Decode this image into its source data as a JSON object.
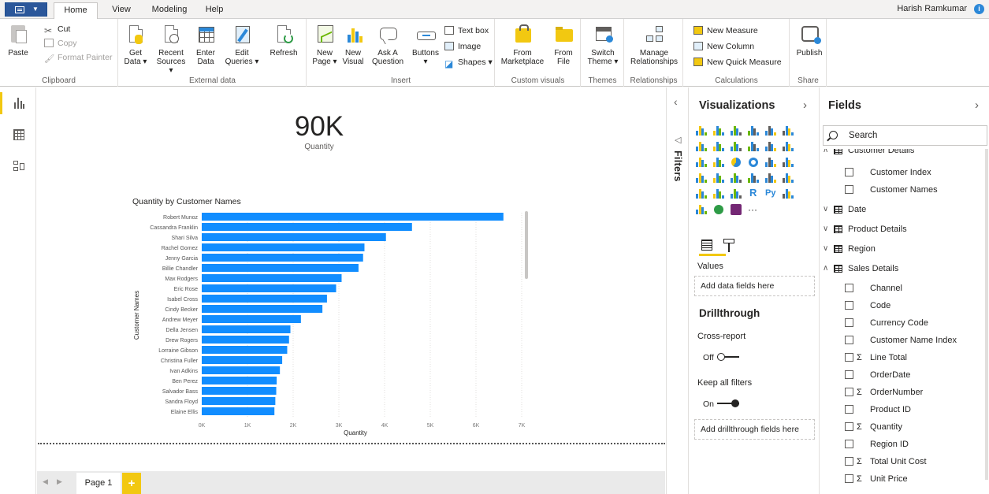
{
  "titlebar": {
    "tabs": [
      "Home",
      "View",
      "Modeling",
      "Help"
    ],
    "active_tab": "Home",
    "user": "Harish Ramkumar"
  },
  "ribbon": {
    "clipboard": {
      "label": "Clipboard",
      "paste": "Paste",
      "cut": "Cut",
      "copy": "Copy",
      "format_painter": "Format Painter"
    },
    "external_data": {
      "label": "External data",
      "get_data": [
        "Get",
        "Data ▾"
      ],
      "recent_sources": [
        "Recent",
        "Sources ▾"
      ],
      "enter_data": [
        "Enter",
        "Data"
      ],
      "edit_queries": [
        "Edit",
        "Queries ▾"
      ],
      "refresh": "Refresh"
    },
    "insert": {
      "label": "Insert",
      "new_page": [
        "New",
        "Page ▾"
      ],
      "new_visual": [
        "New",
        "Visual"
      ],
      "ask_question": [
        "Ask A",
        "Question"
      ],
      "buttons": [
        "Buttons",
        "▾"
      ],
      "text_box": "Text box",
      "image": "Image",
      "shapes": "Shapes ▾"
    },
    "custom_visuals": {
      "label": "Custom visuals",
      "from_marketplace": [
        "From",
        "Marketplace"
      ],
      "from_file": [
        "From",
        "File"
      ]
    },
    "themes": {
      "label": "Themes",
      "switch_theme": [
        "Switch",
        "Theme ▾"
      ]
    },
    "relationships": {
      "label": "Relationships",
      "manage": [
        "Manage",
        "Relationships"
      ]
    },
    "calculations": {
      "label": "Calculations",
      "new_measure": "New Measure",
      "new_column": "New Column",
      "new_quick_measure": "New Quick Measure"
    },
    "share": {
      "label": "Share",
      "publish": "Publish"
    }
  },
  "card": {
    "value": "90K",
    "label": "Quantity"
  },
  "chart_data": {
    "type": "bar",
    "orientation": "horizontal",
    "title": "Quantity by Customer Names",
    "xlabel": "Quantity",
    "ylabel": "Customer Names",
    "xlim": [
      0,
      7000
    ],
    "x_ticks": [
      "0K",
      "1K",
      "2K",
      "3K",
      "4K",
      "5K",
      "6K",
      "7K"
    ],
    "categories": [
      "Robert Munoz",
      "Cassandra Franklin",
      "Shari Silva",
      "Rachel Gomez",
      "Jenny Garcia",
      "Billie Chandler",
      "Max Rodgers",
      "Eric Rose",
      "Isabel Cross",
      "Cindy Becker",
      "Andrew Meyer",
      "Della Jensen",
      "Drew Rogers",
      "Lorraine Gibson",
      "Christina Fuller",
      "Ivan Adkins",
      "Ben Perez",
      "Salvador Bass",
      "Sandra Floyd",
      "Elaine Ellis"
    ],
    "values": [
      6600,
      4600,
      4030,
      3560,
      3530,
      3430,
      3060,
      2940,
      2740,
      2640,
      2170,
      1940,
      1910,
      1870,
      1760,
      1710,
      1640,
      1630,
      1610,
      1590
    ],
    "bar_color": "#118dff",
    "grid": "vertical dotted"
  },
  "page_tabs": {
    "page": "Page 1",
    "add": "+"
  },
  "filters": {
    "label": "Filters"
  },
  "visualizations": {
    "title": "Visualizations",
    "values_label": "Values",
    "values_placeholder": "Add data fields here",
    "drillthrough_title": "Drillthrough",
    "cross_report": "Cross-report",
    "cross_report_state": "Off",
    "keep_all_filters": "Keep all filters",
    "keep_all_filters_state": "On",
    "drill_placeholder": "Add drillthrough fields here",
    "more": "···"
  },
  "fields": {
    "title": "Fields",
    "search_placeholder": "Search",
    "tables": [
      {
        "name": "Customer Details",
        "expanded": true,
        "fields": [
          {
            "name": "Customer Index",
            "sigma": false
          },
          {
            "name": "Customer Names",
            "sigma": false
          }
        ]
      },
      {
        "name": "Date",
        "expanded": false,
        "fields": []
      },
      {
        "name": "Product Details",
        "expanded": false,
        "fields": []
      },
      {
        "name": "Region",
        "expanded": false,
        "fields": []
      },
      {
        "name": "Sales Details",
        "expanded": true,
        "fields": [
          {
            "name": "Channel",
            "sigma": false
          },
          {
            "name": "Code",
            "sigma": false
          },
          {
            "name": "Currency Code",
            "sigma": false
          },
          {
            "name": "Customer Name Index",
            "sigma": false
          },
          {
            "name": "Line Total",
            "sigma": true
          },
          {
            "name": "OrderDate",
            "sigma": false
          },
          {
            "name": "OrderNumber",
            "sigma": true
          },
          {
            "name": "Product ID",
            "sigma": false
          },
          {
            "name": "Quantity",
            "sigma": true
          },
          {
            "name": "Region ID",
            "sigma": false
          },
          {
            "name": "Total Unit Cost",
            "sigma": true
          },
          {
            "name": "Unit Price",
            "sigma": true
          }
        ]
      }
    ]
  }
}
